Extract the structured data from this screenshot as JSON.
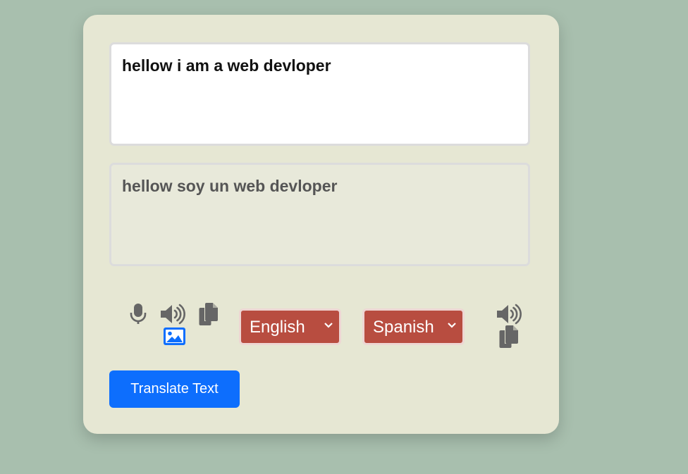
{
  "translator": {
    "source_text": "hellow i am a web devloper",
    "translated_text": "hellow soy un web devloper",
    "source_language": "English",
    "target_language": "Spanish",
    "translate_button_label": "Translate Text"
  },
  "icons": {
    "source_controls": [
      "microphone-icon",
      "speaker-icon",
      "copy-icon",
      "image-icon"
    ],
    "target_controls": [
      "speaker-icon",
      "copy-icon"
    ]
  },
  "colors": {
    "background": "#a8bfae",
    "card": "#e6e7d3",
    "select": "#b84d40",
    "button": "#0d6efd",
    "icon": "#666666",
    "image_icon": "#0d6efd"
  }
}
